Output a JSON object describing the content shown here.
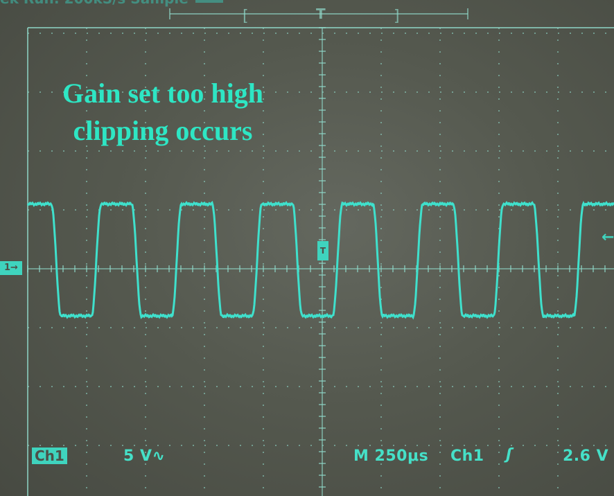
{
  "top_status": {
    "text": "ek Run: 200kS/s    Sample"
  },
  "annotation": {
    "line1": "Gain set too high",
    "line2": "clipping occurs"
  },
  "channel": {
    "badge": "Ch1",
    "volts_per_div": "5 V∿",
    "marker": "1→"
  },
  "horizontal": {
    "timebase": "M 250μs",
    "trigger_marker": "T",
    "window_mark": "T"
  },
  "trigger": {
    "source": "Ch1",
    "slope": "ʃ",
    "level": "2.6 V"
  },
  "colors": {
    "trace": "#3fe0cc",
    "graticule": "#8fd7c8",
    "text": "#45e0c8",
    "screen": "#55594f"
  },
  "waveform": {
    "type": "clipped-square-wave",
    "cycles_visible": 7.2,
    "high_div": 1.1,
    "low_div": -0.8
  }
}
